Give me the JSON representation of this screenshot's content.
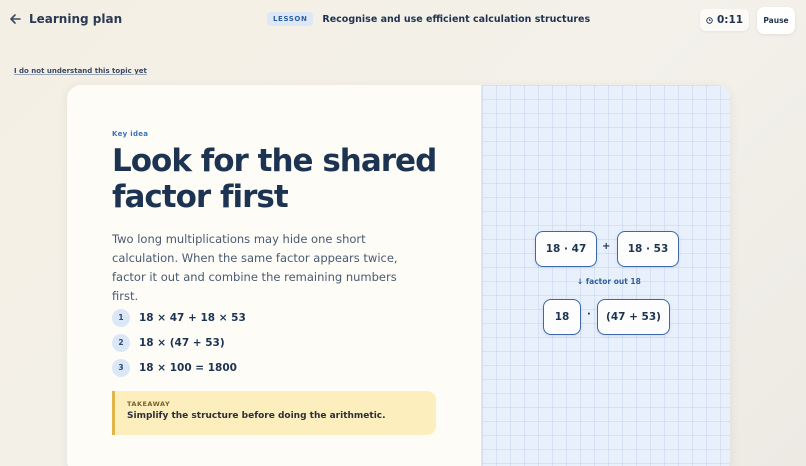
{
  "header": {
    "back_label": "Learning plan",
    "lesson_badge": "LESSON",
    "lesson_title": "Recognise and use efficient calculation structures",
    "timer": "0:11",
    "pause_label": "Pause"
  },
  "help_link": "I do not understand this topic yet",
  "content": {
    "kicker": "Key idea",
    "heading": "Look for the shared factor first",
    "paragraph": "Two long multiplications may hide one short calculation. When the same factor appears twice, factor it out and combine the remaining numbers first.",
    "steps": [
      {
        "num": "1",
        "expr": "18 × 47 + 18 × 53"
      },
      {
        "num": "2",
        "expr": "18 × (47 + 53)"
      },
      {
        "num": "3",
        "expr": "18 × 100 = 1800"
      }
    ],
    "takeaway": {
      "label": "TAKEAWAY",
      "text": "Simplify the structure before doing the arithmetic."
    }
  },
  "diagram": {
    "term1": "18 · 47",
    "plus": "+",
    "term2": "18 · 53",
    "arrow_label": "↓ factor out 18",
    "factor": "18",
    "dot": "·",
    "sum": "(47 + 53)"
  },
  "colors": {
    "accent": "#3b73b9",
    "heading": "#1c3452",
    "takeaway_bg": "#fcefbd",
    "takeaway_border": "#e0b64a",
    "grid_bg": "#e8f0fb"
  }
}
